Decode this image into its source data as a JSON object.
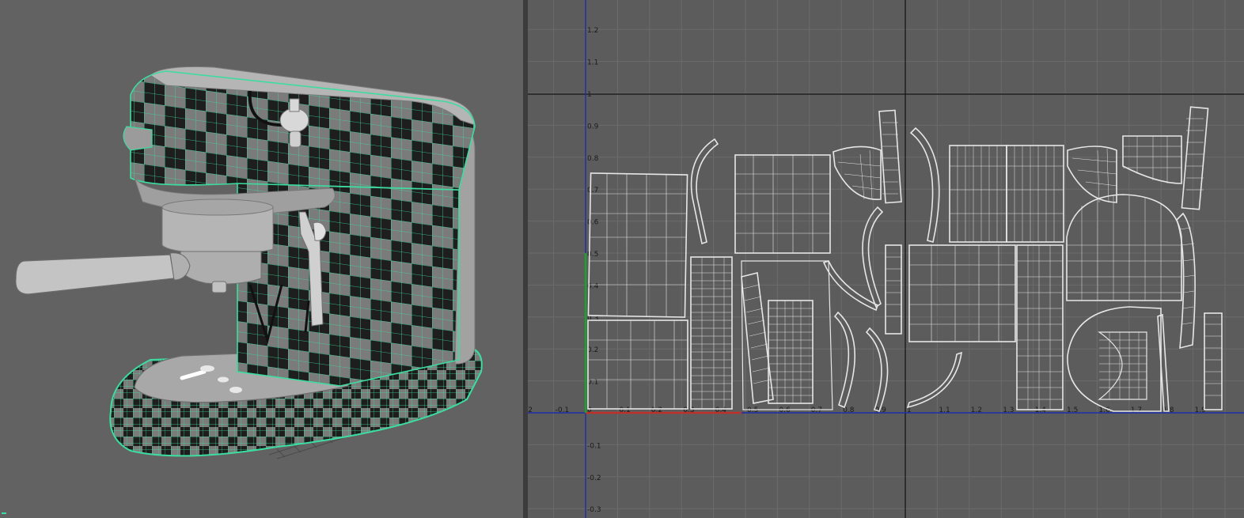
{
  "viewport3d": {
    "object": "espresso-machine",
    "colors": {
      "background": "#626262",
      "wire": "#3ddca0",
      "checker_dark": "#1e1e1e",
      "checker_light": "#7a7a7a",
      "body": "#9b9b9b"
    }
  },
  "uv_editor": {
    "colors": {
      "background": "#5c5c5c",
      "grid": "#6b6b6b",
      "u_axis": "#1d2fa8",
      "v_axis": "#1d2fa8",
      "udim_border": "#111111",
      "shell": "#e6e6e6",
      "origin_mark": "#c0302a"
    },
    "u_ticks": [
      "-.2",
      "-0.1",
      "0",
      "0.1",
      "0.2",
      "0.3",
      "0.4",
      "0.5",
      "0.6",
      "0.7",
      "0.8",
      "0.9",
      "1",
      "1.1",
      "1.2",
      "1.3",
      "1.4",
      "1.5",
      "1.6",
      "1.7",
      "1.8",
      "1.9"
    ],
    "v_ticks": [
      "1.2",
      "1.1",
      "1",
      "0.9",
      "0.8",
      "0.7",
      "0.6",
      "0.5",
      "0.4",
      "0.3",
      "0.2",
      "0.1",
      "-0.1",
      "-0.2",
      "-0.3"
    ]
  }
}
